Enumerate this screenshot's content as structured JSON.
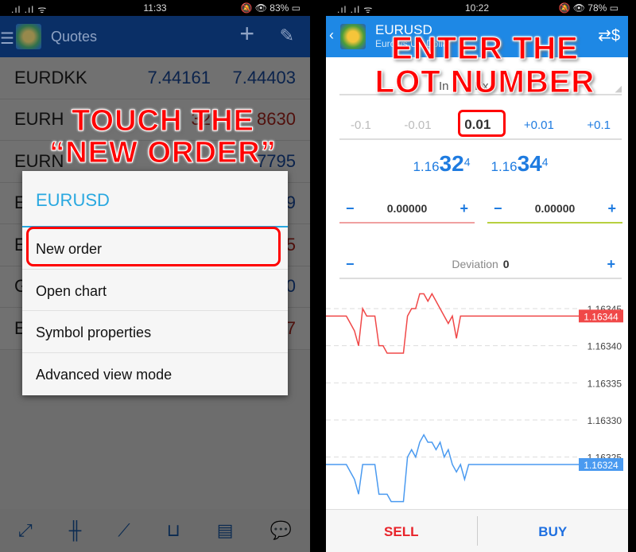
{
  "left": {
    "status": {
      "signal": ".ıl .ıl ᯤ",
      "time": "11:33",
      "right": "🔕 👁 83% ▭"
    },
    "header": {
      "title": "Quotes",
      "menu_icon": "hamburger-icon",
      "plus_icon": "plus-icon",
      "edit_icon": "pencil-icon"
    },
    "rows": [
      {
        "symbol": "EURDKK",
        "bid": "7.44161",
        "ask": "7.44403",
        "color": "blue"
      },
      {
        "symbol": "EURH",
        "bid": "32",
        "ask": "8630",
        "color": "red"
      },
      {
        "symbol": "EURN",
        "bid": "",
        "ask": "7795",
        "color": "blue"
      },
      {
        "symbol": "E",
        "bid": "",
        "ask": "9",
        "color": "blue"
      },
      {
        "symbol": "E",
        "bid": "",
        "ask": "5",
        "color": "red"
      },
      {
        "symbol": "G",
        "bid": "",
        "ask": "0",
        "color": "blue"
      },
      {
        "symbol": "E",
        "bid": "",
        "ask": "7",
        "color": "red"
      }
    ],
    "dialog": {
      "title": "EURUSD",
      "items": [
        "New order",
        "Open chart",
        "Symbol properties",
        "Advanced view mode"
      ]
    },
    "annotation": [
      "TOUCH THE",
      "“NEW ORDER”"
    ],
    "nav_icons": [
      "trade-icon",
      "candlestick-icon",
      "chart-icon",
      "inbox-icon",
      "news-icon",
      "chat-icon"
    ]
  },
  "right": {
    "status": {
      "signal": ".ıl .ıl ᯤ",
      "time": "10:22",
      "right": "🔕 👁 78% ▭"
    },
    "header": {
      "symbol": "EURUSD",
      "sub": "Euro vs US Dollar",
      "partial_left": "In",
      "partial_right": "Ex"
    },
    "lot": {
      "steps": [
        "-0.1",
        "-0.01",
        "0.01",
        "+0.01",
        "+0.1"
      ]
    },
    "prices": {
      "bid": {
        "pre": "1.16",
        "big": "32",
        "sup": "4"
      },
      "ask": {
        "pre": "1.16",
        "big": "34",
        "sup": "4"
      }
    },
    "sl": {
      "minus": "−",
      "value": "0.00000",
      "plus": "+"
    },
    "tp": {
      "minus": "−",
      "value": "0.00000",
      "plus": "+"
    },
    "deviation": {
      "label": "Deviation",
      "value": "0",
      "minus": "−",
      "plus": "+"
    },
    "annotation": [
      "ENTER THE",
      "LOT NUMBER"
    ],
    "sell": "SELL",
    "buy": "BUY",
    "colors": {
      "ask": "#f04848",
      "bid": "#4a9af0",
      "sl_line": "#f0a0a0",
      "tp_line": "#b8d040"
    }
  },
  "chart_data": {
    "type": "line",
    "y_ticks": [
      "1.16345",
      "1.16340",
      "1.16335",
      "1.16330",
      "1.16325"
    ],
    "ylim": [
      1.16318,
      1.16348
    ],
    "series": [
      {
        "current_label": "1.16344",
        "color": "#f04848",
        "values": [
          1.16344,
          1.16344,
          1.16344,
          1.16344,
          1.16344,
          1.16344,
          1.16343,
          1.16342,
          1.1634,
          1.16345,
          1.16344,
          1.16344,
          1.16344,
          1.1634,
          1.1634,
          1.16339,
          1.16339,
          1.16339,
          1.16339,
          1.16339,
          1.16344,
          1.16345,
          1.16345,
          1.16347,
          1.16347,
          1.16346,
          1.16347,
          1.16346,
          1.16345,
          1.16344,
          1.16343,
          1.16344,
          1.16341,
          1.16344,
          1.16344,
          1.16344,
          1.16344,
          1.16344,
          1.16344,
          1.16344,
          1.16344,
          1.16344,
          1.16344,
          1.16344,
          1.16344,
          1.16344,
          1.16344,
          1.16344,
          1.16344,
          1.16344,
          1.16344,
          1.16344,
          1.16344,
          1.16344,
          1.16344,
          1.16344,
          1.16344,
          1.16344,
          1.16344,
          1.16344,
          1.16344,
          1.16344,
          1.16344
        ]
      },
      {
        "current_label": "1.16324",
        "color": "#4a9af0",
        "values": [
          1.16324,
          1.16324,
          1.16324,
          1.16324,
          1.16324,
          1.16324,
          1.16323,
          1.16322,
          1.1632,
          1.16324,
          1.16324,
          1.16324,
          1.16324,
          1.1632,
          1.1632,
          1.1632,
          1.16319,
          1.16319,
          1.16319,
          1.16319,
          1.16325,
          1.16326,
          1.16325,
          1.16327,
          1.16328,
          1.16327,
          1.16327,
          1.16326,
          1.16327,
          1.16325,
          1.16326,
          1.16324,
          1.16323,
          1.16324,
          1.16322,
          1.16324,
          1.16324,
          1.16324,
          1.16324,
          1.16324,
          1.16324,
          1.16324,
          1.16324,
          1.16324,
          1.16324,
          1.16324,
          1.16324,
          1.16324,
          1.16324,
          1.16324,
          1.16324,
          1.16324,
          1.16324,
          1.16324,
          1.16324,
          1.16324,
          1.16324,
          1.16324,
          1.16324,
          1.16324,
          1.16324,
          1.16324,
          1.16324
        ]
      }
    ]
  }
}
